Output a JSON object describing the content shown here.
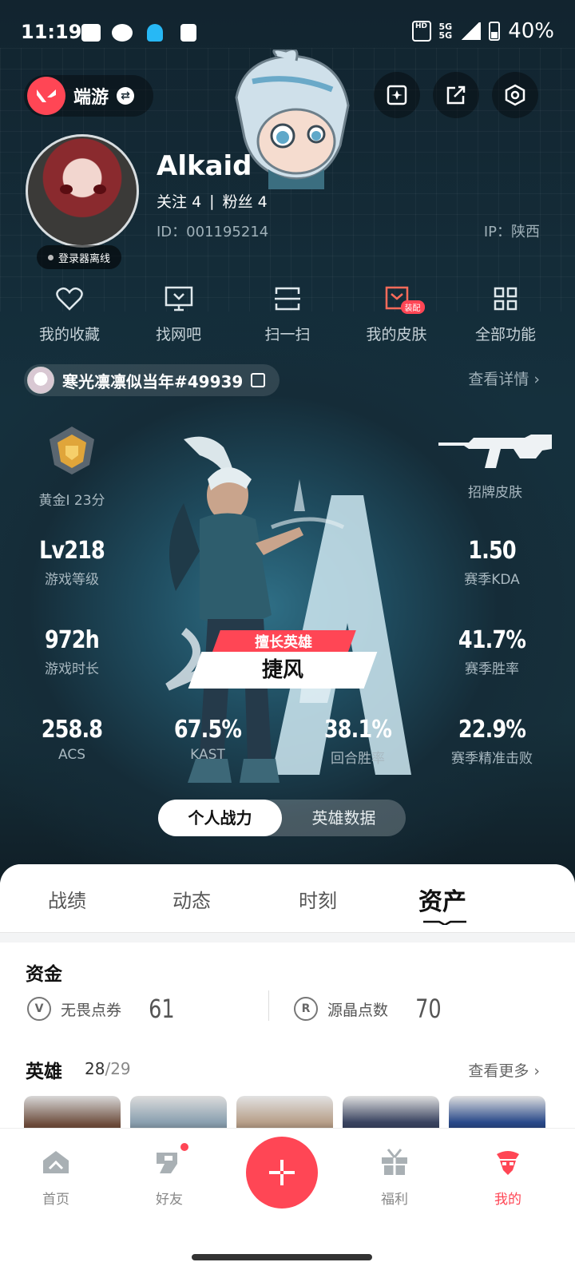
{
  "status_bar": {
    "time": "11:19",
    "network": "5G",
    "battery": "40%"
  },
  "header": {
    "app_name": "端游"
  },
  "profile": {
    "username": "Alkaid",
    "follow_label": "关注",
    "follow_count": "4",
    "separator": "|",
    "fans_label": "粉丝",
    "fans_count": "4",
    "id_text": "ID：001195214",
    "ip_text": "IP：陕西",
    "online_status": "登录器离线"
  },
  "quick_functions": [
    {
      "label": "我的收藏",
      "icon": "heart-icon"
    },
    {
      "label": "找网吧",
      "icon": "monitor-icon"
    },
    {
      "label": "扫一扫",
      "icon": "scan-icon"
    },
    {
      "label": "我的皮肤",
      "icon": "skin-icon",
      "badge": "装配"
    },
    {
      "label": "全部功能",
      "icon": "grid-icon"
    }
  ],
  "account": {
    "game_name": "寒光凛凛似当年#49939",
    "detail_link": "查看详情 ›"
  },
  "stats": {
    "rank": {
      "value": "",
      "label": "黄金I 23分"
    },
    "skin": {
      "label": "招牌皮肤"
    },
    "level": {
      "value": "Lv218",
      "label": "游戏等级"
    },
    "kda": {
      "value": "1.50",
      "label": "赛季KDA"
    },
    "hours": {
      "value": "972h",
      "label": "游戏时长"
    },
    "winrate": {
      "value": "41.7%",
      "label": "赛季胜率"
    },
    "acs": {
      "value": "258.8",
      "label": "ACS"
    },
    "kast": {
      "value": "67.5%",
      "label": "KAST"
    },
    "round_win": {
      "value": "38.1%",
      "label": "回合胜率"
    },
    "precise": {
      "value": "22.9%",
      "label": "赛季精准击败"
    }
  },
  "hero_banner": {
    "top": "擅长英雄",
    "name": "捷风"
  },
  "toggle": {
    "personal": "个人战力",
    "hero_data": "英雄数据"
  },
  "tabs": [
    "战绩",
    "动态",
    "时刻",
    "资产"
  ],
  "assets": {
    "funds_title": "资金",
    "vp_label": "无畏点券",
    "vp_value": "61",
    "rp_label": "源晶点数",
    "rp_value": "70",
    "heroes_title": "英雄",
    "heroes_owned": "28",
    "heroes_sep": "/",
    "heroes_total": "29",
    "see_more": "查看更多 ›"
  },
  "bottom_nav": [
    {
      "label": "首页",
      "icon": "home-icon"
    },
    {
      "label": "好友",
      "icon": "friends-icon"
    },
    {
      "label": "",
      "icon": "plus-icon"
    },
    {
      "label": "福利",
      "icon": "gift-icon"
    },
    {
      "label": "我的",
      "icon": "profile-icon"
    }
  ],
  "colors": {
    "accent": "#ff4655",
    "bg_dark": "#12242f"
  }
}
